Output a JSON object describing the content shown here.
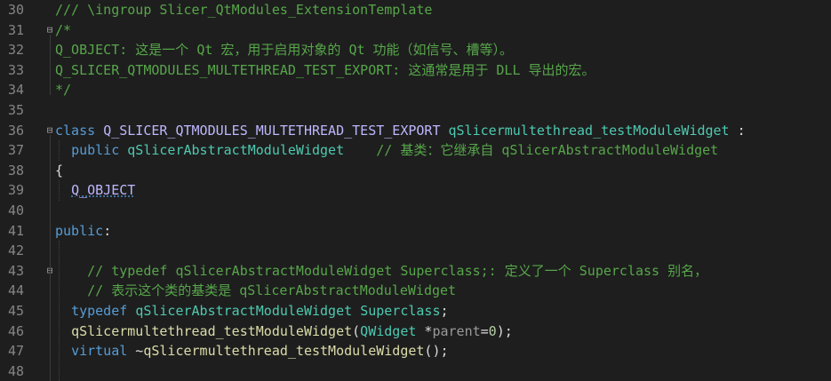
{
  "editor": {
    "lines": [
      {
        "num": "30",
        "fold": "",
        "tokens": [
          {
            "t": "/// \\ingroup Slicer_QtModules_ExtensionTemplate",
            "c": "cmt"
          }
        ]
      },
      {
        "num": "31",
        "fold": "⊟",
        "tokens": [
          {
            "t": "/*",
            "c": "cmt"
          }
        ]
      },
      {
        "num": "32",
        "fold": "",
        "tokens": [
          {
            "t": "Q_OBJECT: 这是一个 Qt 宏，用于启用对象的 Qt 功能（如信号、槽等）。",
            "c": "cmt"
          }
        ]
      },
      {
        "num": "33",
        "fold": "",
        "tokens": [
          {
            "t": "Q_SLICER_QTMODULES_MULTETHREAD_TEST_EXPORT: 这通常是用于 DLL 导出的宏。",
            "c": "cmt"
          }
        ]
      },
      {
        "num": "34",
        "fold": "",
        "tokens": [
          {
            "t": "*/",
            "c": "cmt"
          }
        ]
      },
      {
        "num": "35",
        "fold": "",
        "tokens": []
      },
      {
        "num": "36",
        "fold": "⊟",
        "tokens": [
          {
            "t": "class",
            "c": "kw"
          },
          {
            "t": " ",
            "c": "pl"
          },
          {
            "t": "Q_SLICER_QTMODULES_MULTETHREAD_TEST_EXPORT",
            "c": "mac"
          },
          {
            "t": " ",
            "c": "pl"
          },
          {
            "t": "qSlicermultethread_testModuleWidget",
            "c": "cls"
          },
          {
            "t": " :",
            "c": "pl"
          }
        ]
      },
      {
        "num": "37",
        "fold": "",
        "tokens": [
          {
            "t": "  ",
            "c": "pl"
          },
          {
            "t": "public",
            "c": "kw"
          },
          {
            "t": " ",
            "c": "pl"
          },
          {
            "t": "qSlicerAbstractModuleWidget",
            "c": "cls"
          },
          {
            "t": "    ",
            "c": "pl"
          },
          {
            "t": "// 基类：它继承自 qSlicerAbstractModuleWidget",
            "c": "cmt"
          }
        ]
      },
      {
        "num": "38",
        "fold": "",
        "tokens": [
          {
            "t": "{",
            "c": "pl"
          }
        ]
      },
      {
        "num": "39",
        "fold": "",
        "tokens": [
          {
            "t": "  ",
            "c": "pl"
          },
          {
            "t": "Q_OBJECT",
            "c": "mac squig"
          }
        ]
      },
      {
        "num": "40",
        "fold": "",
        "tokens": []
      },
      {
        "num": "41",
        "fold": "",
        "tokens": [
          {
            "t": "public",
            "c": "kw"
          },
          {
            "t": ":",
            "c": "pl"
          }
        ]
      },
      {
        "num": "42",
        "fold": "",
        "tokens": []
      },
      {
        "num": "43",
        "fold": "⊟",
        "tokens": [
          {
            "t": "    // typedef qSlicerAbstractModuleWidget Superclass;: 定义了一个 Superclass 别名，",
            "c": "cmt"
          }
        ]
      },
      {
        "num": "44",
        "fold": "",
        "tokens": [
          {
            "t": "    // 表示这个类的基类是 qSlicerAbstractModuleWidget",
            "c": "cmt"
          }
        ]
      },
      {
        "num": "45",
        "fold": "",
        "tokens": [
          {
            "t": "  ",
            "c": "pl"
          },
          {
            "t": "typedef",
            "c": "kw"
          },
          {
            "t": " ",
            "c": "pl"
          },
          {
            "t": "qSlicerAbstractModuleWidget",
            "c": "cls"
          },
          {
            "t": " ",
            "c": "pl"
          },
          {
            "t": "Superclass",
            "c": "cls"
          },
          {
            "t": ";",
            "c": "pl"
          }
        ]
      },
      {
        "num": "46",
        "fold": "",
        "tokens": [
          {
            "t": "  ",
            "c": "pl"
          },
          {
            "t": "qSlicermultethread_testModuleWidget",
            "c": "fn"
          },
          {
            "t": "(",
            "c": "pl"
          },
          {
            "t": "QWidget",
            "c": "cls"
          },
          {
            "t": " *",
            "c": "pl"
          },
          {
            "t": "parent",
            "c": "prm"
          },
          {
            "t": "=",
            "c": "pl"
          },
          {
            "t": "0",
            "c": "num"
          },
          {
            "t": ");",
            "c": "pl"
          }
        ]
      },
      {
        "num": "47",
        "fold": "",
        "tokens": [
          {
            "t": "  ",
            "c": "pl"
          },
          {
            "t": "virtual",
            "c": "kw"
          },
          {
            "t": " ~",
            "c": "pl"
          },
          {
            "t": "qSlicermultethread_testModuleWidget",
            "c": "fn"
          },
          {
            "t": "();",
            "c": "pl"
          }
        ]
      },
      {
        "num": "48",
        "fold": "",
        "tokens": []
      }
    ]
  }
}
